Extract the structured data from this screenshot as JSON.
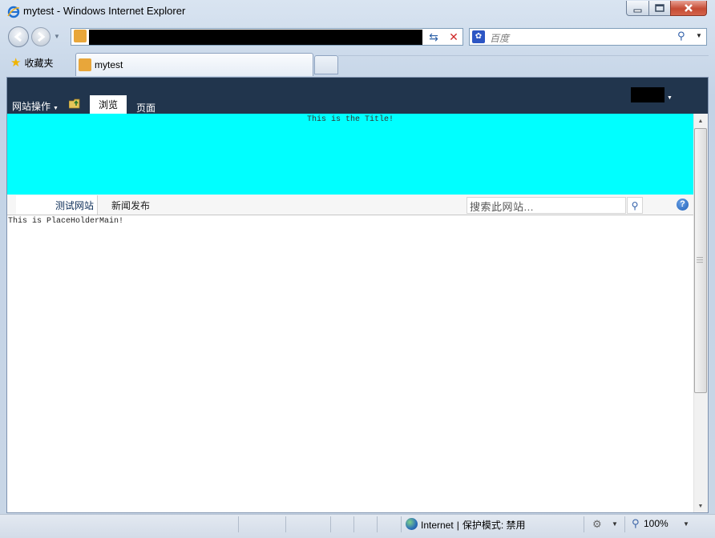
{
  "window": {
    "title": "mytest - Windows Internet Explorer"
  },
  "toolbar": {
    "search_placeholder": "百度",
    "search_engine_icon": "paw-icon",
    "refresh_icon": "refresh-icon",
    "stop_icon": "stop-icon"
  },
  "tabs": {
    "favorites_label": "收藏夹",
    "active_tab_label": "mytest"
  },
  "ribbon": {
    "site_actions": "网站操作",
    "tab_browse": "浏览",
    "tab_page": "页面",
    "background": "#21354d"
  },
  "page": {
    "title": "This is the Title!",
    "title_area_color": "#00ffff",
    "nav": [
      "测试网站",
      "新闻发布"
    ],
    "site_search_placeholder": "搜索此网站...",
    "main_text": "This is PlaceHolderMain!"
  },
  "status": {
    "zone": "Internet",
    "protected_mode": "保护模式: 禁用",
    "zoom": "100%"
  }
}
